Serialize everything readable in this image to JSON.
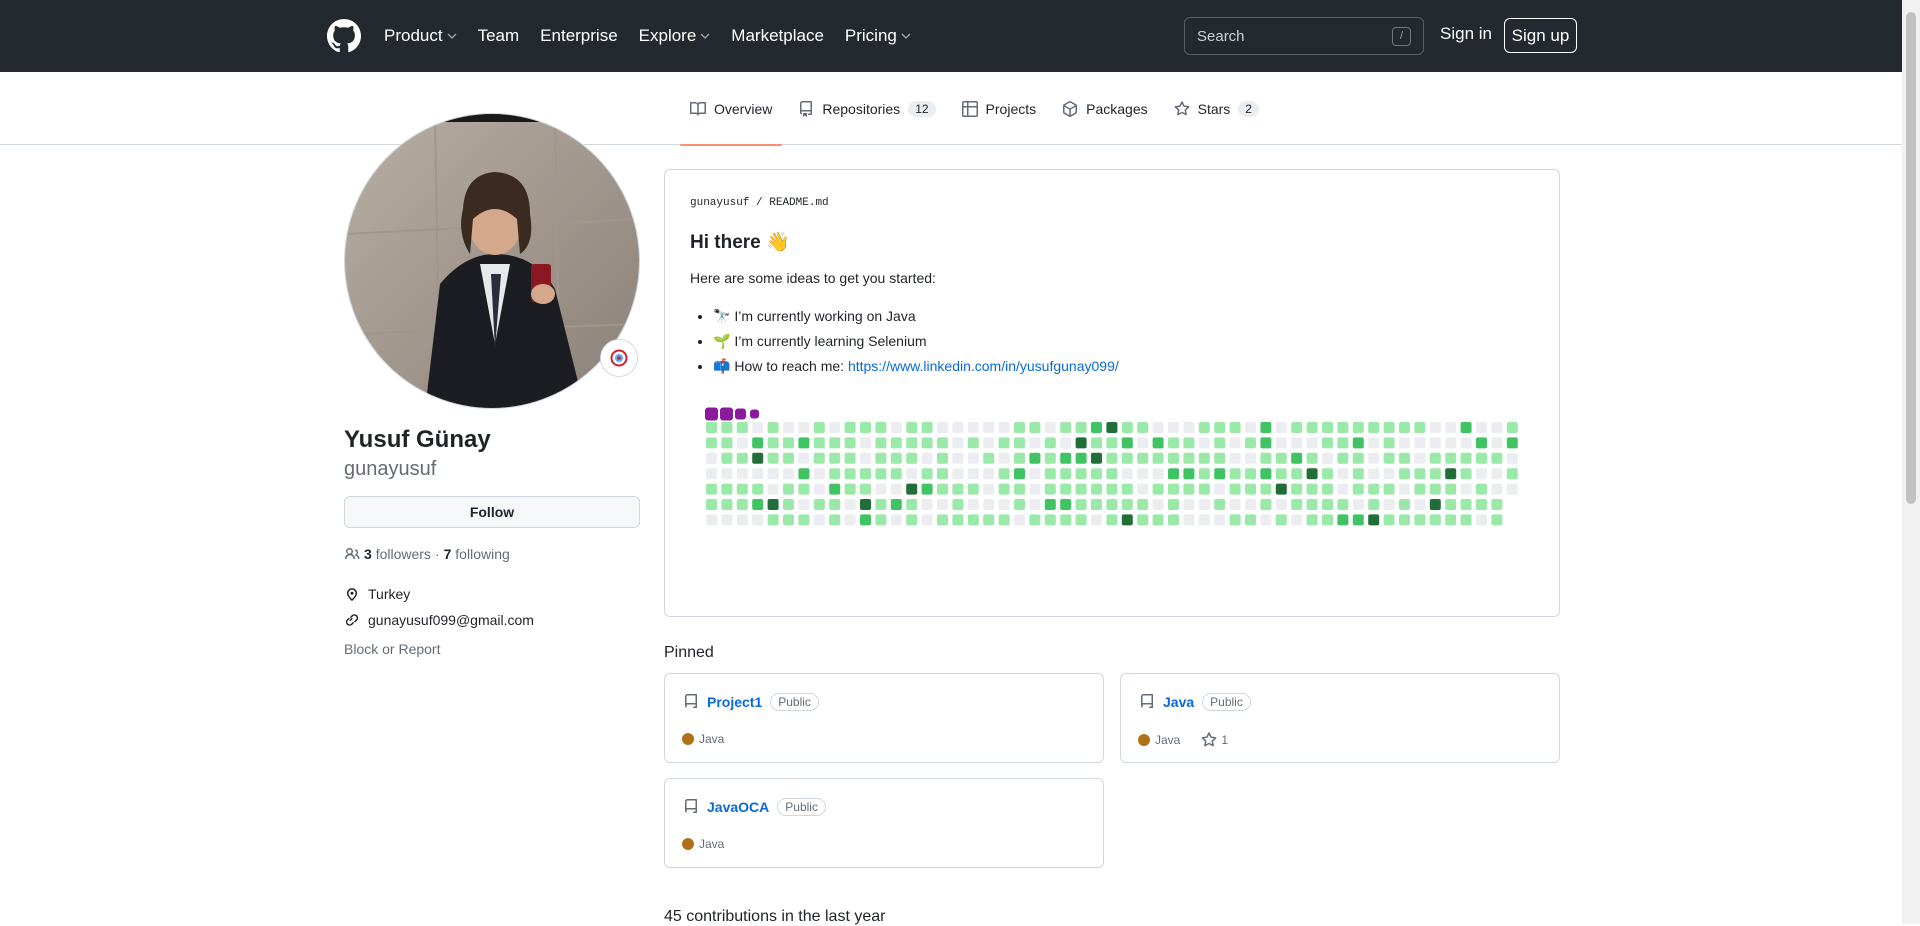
{
  "header": {
    "nav": [
      {
        "label": "Product",
        "dropdown": true
      },
      {
        "label": "Team",
        "dropdown": false
      },
      {
        "label": "Enterprise",
        "dropdown": false
      },
      {
        "label": "Explore",
        "dropdown": true
      },
      {
        "label": "Marketplace",
        "dropdown": false
      },
      {
        "label": "Pricing",
        "dropdown": true
      }
    ],
    "search_placeholder": "Search",
    "search_shortcut": "/",
    "sign_in": "Sign in",
    "sign_up": "Sign up"
  },
  "tabs": [
    {
      "label": "Overview",
      "count": "",
      "icon": "book-icon",
      "active": true
    },
    {
      "label": "Repositories",
      "count": "12",
      "icon": "repo-icon",
      "active": false
    },
    {
      "label": "Projects",
      "count": "",
      "icon": "table-icon",
      "active": false
    },
    {
      "label": "Packages",
      "count": "",
      "icon": "package-icon",
      "active": false
    },
    {
      "label": "Stars",
      "count": "2",
      "icon": "star-icon",
      "active": false
    }
  ],
  "profile": {
    "name": "Yusuf Günay",
    "login": "gunayusuf",
    "follow_label": "Follow",
    "followers_count": "3",
    "followers_label": "followers",
    "separator": "·",
    "following_count": "7",
    "following_label": "following",
    "location": "Turkey",
    "email": "gunayusuf099@gmail.com",
    "block_report": "Block or Report"
  },
  "readme": {
    "owner": "gunayusuf",
    "slash": "/",
    "file": "README.md",
    "title": "Hi there 👋",
    "intro": "Here are some ideas to get you started:",
    "items": [
      {
        "emoji": "🔭",
        "text": "I’m currently working on Java",
        "link": ""
      },
      {
        "emoji": "🌱",
        "text": "I’m currently learning Selenium",
        "link": ""
      },
      {
        "emoji": "📫",
        "text": "How to reach me: ",
        "link": "https://www.linkedin.com/in/yusufgunay099/"
      }
    ]
  },
  "pinned": {
    "title": "Pinned",
    "repos": [
      {
        "name": "Project1",
        "visibility": "Public",
        "language": "Java",
        "stars": ""
      },
      {
        "name": "Java",
        "visibility": "Public",
        "language": "Java",
        "stars": "1"
      },
      {
        "name": "JavaOCA",
        "visibility": "Public",
        "language": "Java",
        "stars": ""
      }
    ]
  },
  "contributions": {
    "summary": "45 contributions in the last year"
  },
  "colors": {
    "header_bg": "#24292f",
    "link": "#0969da",
    "tab_underline": "#fd8c73",
    "java": "#b07219"
  }
}
